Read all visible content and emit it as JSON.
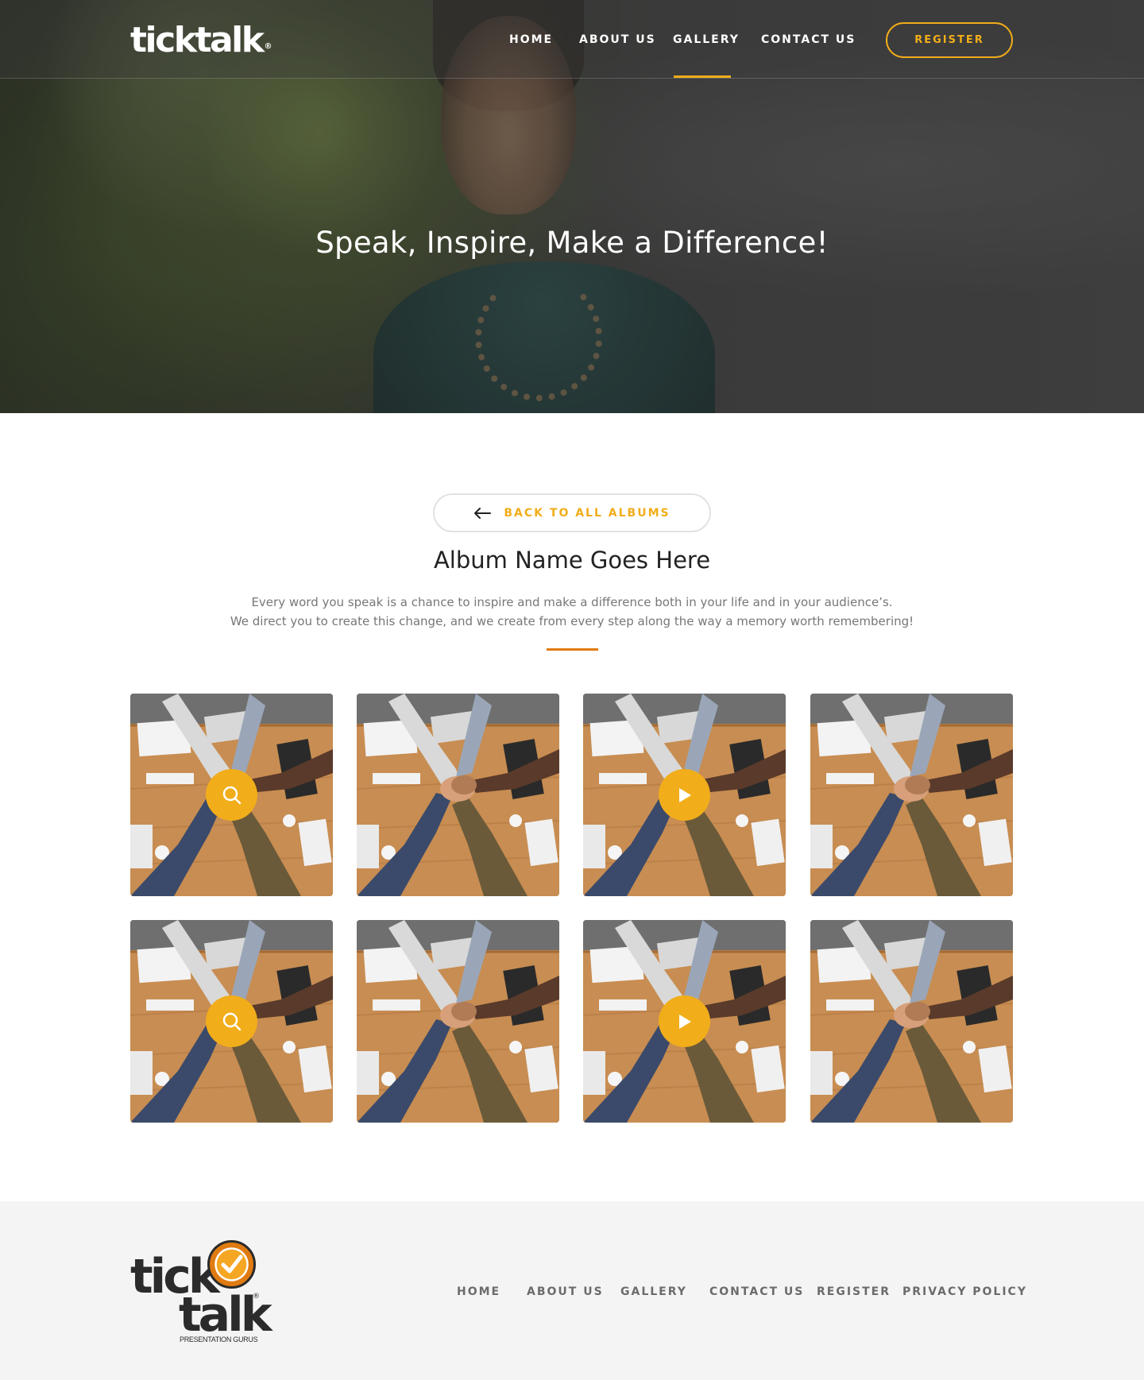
{
  "brand": {
    "name": "ticktalk",
    "trademark": "®",
    "footer_word_1": "tick",
    "footer_word_2": "talk",
    "tagline": "PRESENTATION GURUS",
    "accent_color": "#f1ad1a",
    "divider_color": "#e07b12"
  },
  "nav": {
    "items": [
      {
        "label": "HOME",
        "active": false
      },
      {
        "label": "ABOUT US",
        "active": false
      },
      {
        "label": "GALLERY",
        "active": true
      },
      {
        "label": "CONTACT US",
        "active": false
      }
    ],
    "register_label": "REGISTER"
  },
  "hero": {
    "title": "Speak, Inspire, Make a Difference!"
  },
  "album": {
    "back_label": "BACK TO ALL ALBUMS",
    "back_icon": "arrow-left-icon",
    "title": "Album Name Goes Here",
    "description_lines": [
      "Every word you speak is a chance to inspire and make a difference both in your life and in your audience’s.",
      "We direct you to create this change, and we create from every step along the way a memory worth remembering!"
    ],
    "items": [
      {
        "overlay": "search-icon"
      },
      {
        "overlay": ""
      },
      {
        "overlay": "play-icon"
      },
      {
        "overlay": ""
      },
      {
        "overlay": "search-icon"
      },
      {
        "overlay": ""
      },
      {
        "overlay": "play-icon"
      },
      {
        "overlay": ""
      }
    ]
  },
  "footer": {
    "links": [
      "HOME",
      "ABOUT US",
      "GALLERY",
      "CONTACT US",
      "REGISTER",
      "PRIVACY POLICY"
    ]
  }
}
